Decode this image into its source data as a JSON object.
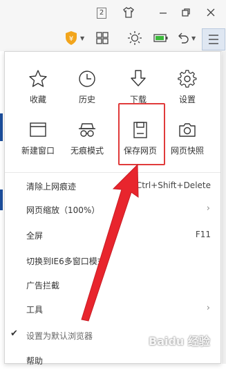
{
  "titlebar": {
    "tab_count": "2"
  },
  "menu": {
    "grid": [
      {
        "label": "收藏",
        "icon": "star-icon"
      },
      {
        "label": "历史",
        "icon": "clock-icon"
      },
      {
        "label": "下载",
        "icon": "download-icon"
      },
      {
        "label": "设置",
        "icon": "gear-icon"
      },
      {
        "label": "新建窗口",
        "icon": "window-icon"
      },
      {
        "label": "无痕模式",
        "icon": "glasses-icon"
      },
      {
        "label": "保存网页",
        "icon": "save-icon"
      },
      {
        "label": "网页快照",
        "icon": "camera-icon"
      }
    ],
    "items": [
      {
        "label": "清除上网痕迹",
        "shortcut": "Ctrl+Shift+Delete"
      },
      {
        "label": "网页缩放（100%）",
        "arrow": "›"
      },
      {
        "label": "全屏",
        "shortcut": "F11"
      },
      {
        "label": "切换到IE6多窗口模式"
      },
      {
        "label": "广告拦截"
      },
      {
        "label": "工具",
        "arrow": "›"
      },
      {
        "label": "设置为默认浏览器",
        "check": "✔"
      },
      {
        "label": "帮助"
      }
    ]
  },
  "highlight_color": "#e03a3a",
  "watermark": "Baidu 经验"
}
